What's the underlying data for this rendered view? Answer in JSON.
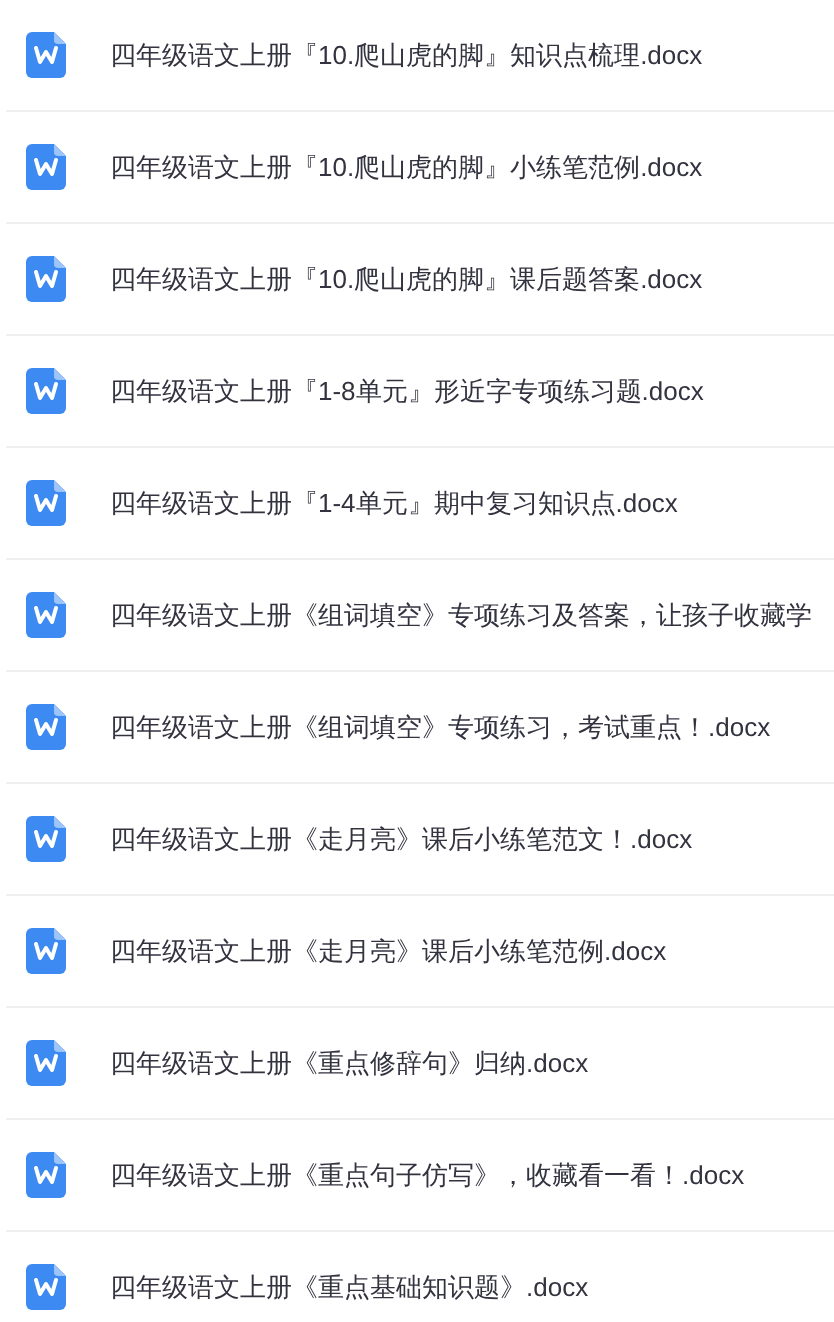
{
  "files": [
    {
      "name": "四年级语文上册『10.爬山虎的脚』知识点梳理.docx"
    },
    {
      "name": "四年级语文上册『10.爬山虎的脚』小练笔范例.docx"
    },
    {
      "name": "四年级语文上册『10.爬山虎的脚』课后题答案.docx"
    },
    {
      "name": "四年级语文上册『1-8单元』形近字专项练习题.docx"
    },
    {
      "name": "四年级语文上册『1-4单元』期中复习知识点.docx"
    },
    {
      "name": "四年级语文上册《组词填空》专项练习及答案，让孩子收藏学"
    },
    {
      "name": "四年级语文上册《组词填空》专项练习，考试重点！.docx"
    },
    {
      "name": "四年级语文上册《走月亮》课后小练笔范文！.docx"
    },
    {
      "name": "四年级语文上册《走月亮》课后小练笔范例.docx"
    },
    {
      "name": "四年级语文上册《重点修辞句》归纳.docx"
    },
    {
      "name": "四年级语文上册《重点句子仿写》，收藏看一看！.docx"
    },
    {
      "name": "四年级语文上册《重点基础知识题》.docx"
    }
  ]
}
